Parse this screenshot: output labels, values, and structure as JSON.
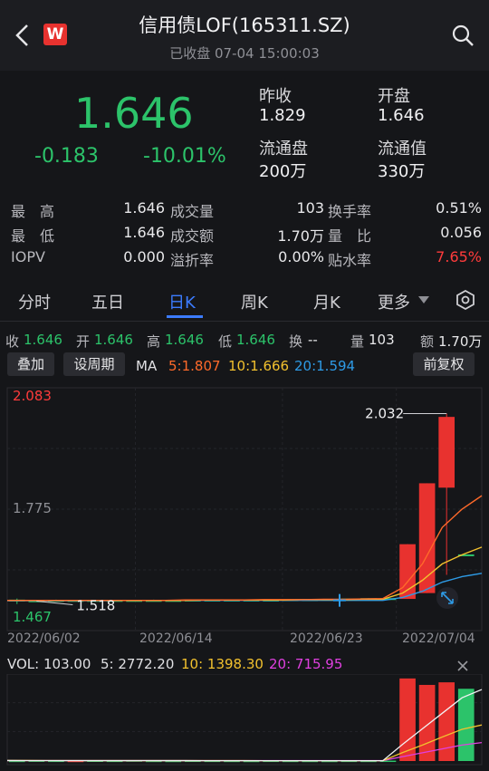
{
  "header": {
    "title": "信用债LOF(165311.SZ)",
    "status": "已收盘 07-04 15:00:03",
    "back_icon": "chevron-left-icon",
    "logo_text": "W",
    "search_icon": "search-icon"
  },
  "quote": {
    "price": "1.646",
    "change": "-0.183",
    "change_pct": "-10.01%",
    "prev_close_label": "昨收",
    "prev_close": "1.829",
    "open_label": "开盘",
    "open": "1.646",
    "float_shares_label": "流通盘",
    "float_shares": "200万",
    "float_value_label": "流通值",
    "float_value": "330万"
  },
  "stats": [
    [
      {
        "label": "最　高",
        "value": "1.646"
      },
      {
        "label": "成交量",
        "value": "103"
      },
      {
        "label": "换手率",
        "value": "0.51%"
      }
    ],
    [
      {
        "label": "最　低",
        "value": "1.646"
      },
      {
        "label": "成交额",
        "value": "1.70万"
      },
      {
        "label": "量　比",
        "value": "0.056"
      }
    ],
    [
      {
        "label": "IOPV",
        "value": "0.000"
      },
      {
        "label": "溢折率",
        "value": "0.00%"
      },
      {
        "label": "贴水率",
        "value": "7.65%"
      }
    ]
  ],
  "tabs": [
    "分时",
    "五日",
    "日K",
    "周K",
    "月K",
    "更多"
  ],
  "active_tab": "日K",
  "ohlc_bar": {
    "close_label": "收",
    "close": "1.646",
    "open_label": "开",
    "open": "1.646",
    "high_label": "高",
    "high": "1.646",
    "low_label": "低",
    "low": "1.646",
    "turnover_label": "换",
    "turnover": "--",
    "volume_label": "量",
    "volume": "103",
    "amount_label": "额",
    "amount": "1.70万"
  },
  "toolbar": {
    "overlay_label": "叠加",
    "period_label": "设周期",
    "ma_label": "MA",
    "ma5": "5:1.807",
    "ma10": "10:1.666",
    "ma20": "20:1.594",
    "adjust_label": "前复权"
  },
  "colors": {
    "up": "#e8322f",
    "down": "#2cc36a",
    "ma5": "#ff6a2a",
    "ma10": "#f2c12e",
    "ma20": "#2e9be6",
    "vol_ma20": "#e040e0",
    "accent": "#3c7cff"
  },
  "chart_data": {
    "type": "candlestick",
    "ylim": [
      1.467,
      2.083
    ],
    "y_ticks": [
      "2.083",
      "1.775",
      "1.467"
    ],
    "annotations": {
      "max": "2.032",
      "min": "1.518"
    },
    "x_ticks": [
      "2022/06/02",
      "2022/06/14",
      "2022/06/23",
      "2022/07/04"
    ],
    "candles": [
      {
        "o": 1.52,
        "h": 1.525,
        "l": 1.51,
        "c": 1.522
      },
      {
        "o": 1.52,
        "h": 1.52,
        "l": 1.518,
        "c": 1.52
      },
      {
        "o": 1.521,
        "h": 1.522,
        "l": 1.52,
        "c": 1.521
      },
      {
        "o": 1.52,
        "h": 1.521,
        "l": 1.52,
        "c": 1.521
      },
      {
        "o": 1.521,
        "h": 1.521,
        "l": 1.52,
        "c": 1.52
      },
      {
        "o": 1.52,
        "h": 1.521,
        "l": 1.52,
        "c": 1.521
      },
      {
        "o": 1.521,
        "h": 1.521,
        "l": 1.52,
        "c": 1.521
      },
      {
        "o": 1.521,
        "h": 1.522,
        "l": 1.52,
        "c": 1.521
      },
      {
        "o": 1.521,
        "h": 1.521,
        "l": 1.52,
        "c": 1.521
      },
      {
        "o": 1.521,
        "h": 1.522,
        "l": 1.521,
        "c": 1.522
      },
      {
        "o": 1.522,
        "h": 1.522,
        "l": 1.521,
        "c": 1.521
      },
      {
        "o": 1.521,
        "h": 1.522,
        "l": 1.521,
        "c": 1.522
      },
      {
        "o": 1.522,
        "h": 1.522,
        "l": 1.521,
        "c": 1.522
      },
      {
        "o": 1.522,
        "h": 1.523,
        "l": 1.522,
        "c": 1.522
      },
      {
        "o": 1.522,
        "h": 1.523,
        "l": 1.522,
        "c": 1.523
      },
      {
        "o": 1.523,
        "h": 1.523,
        "l": 1.522,
        "c": 1.523
      },
      {
        "o": 1.523,
        "h": 1.524,
        "l": 1.523,
        "c": 1.524
      },
      {
        "o": 1.524,
        "h": 1.525,
        "l": 1.524,
        "c": 1.525
      },
      {
        "o": 1.525,
        "h": 1.526,
        "l": 1.525,
        "c": 1.526
      },
      {
        "o": 1.526,
        "h": 1.52,
        "l": 1.52,
        "c": 1.524
      },
      {
        "o": 1.524,
        "h": 1.674,
        "l": 1.524,
        "c": 1.674
      },
      {
        "o": 1.54,
        "h": 1.841,
        "l": 1.54,
        "c": 1.841
      },
      {
        "o": 1.829,
        "h": 2.032,
        "l": 1.59,
        "c": 2.023
      },
      {
        "o": 1.646,
        "h": 1.646,
        "l": 1.646,
        "c": 1.646
      }
    ],
    "ma5": [
      1.52,
      1.52,
      1.52,
      1.52,
      1.52,
      1.52,
      1.52,
      1.52,
      1.52,
      1.521,
      1.521,
      1.521,
      1.521,
      1.522,
      1.522,
      1.522,
      1.523,
      1.523,
      1.524,
      1.525,
      1.555,
      1.62,
      1.72,
      1.77,
      1.807
    ],
    "ma10": [
      1.52,
      1.52,
      1.52,
      1.52,
      1.52,
      1.52,
      1.52,
      1.52,
      1.52,
      1.52,
      1.521,
      1.521,
      1.521,
      1.521,
      1.521,
      1.522,
      1.522,
      1.522,
      1.523,
      1.523,
      1.54,
      1.575,
      1.62,
      1.645,
      1.666
    ],
    "ma20": [
      1.519,
      1.519,
      1.519,
      1.519,
      1.519,
      1.519,
      1.52,
      1.52,
      1.52,
      1.52,
      1.52,
      1.52,
      1.52,
      1.52,
      1.52,
      1.52,
      1.52,
      1.52,
      1.52,
      1.52,
      1.528,
      1.545,
      1.57,
      1.585,
      1.594
    ],
    "volume": {
      "label": "VOL: 103.00",
      "ma5": "5: 2772.20",
      "ma10": "10: 1398.30",
      "ma20": "20: 715.95",
      "values": [
        12,
        20,
        15,
        10,
        18,
        14,
        25,
        12,
        10,
        16,
        14,
        12,
        10,
        15,
        12,
        11,
        10,
        14,
        12,
        16,
        3200,
        2950,
        3050,
        2800
      ]
    }
  }
}
